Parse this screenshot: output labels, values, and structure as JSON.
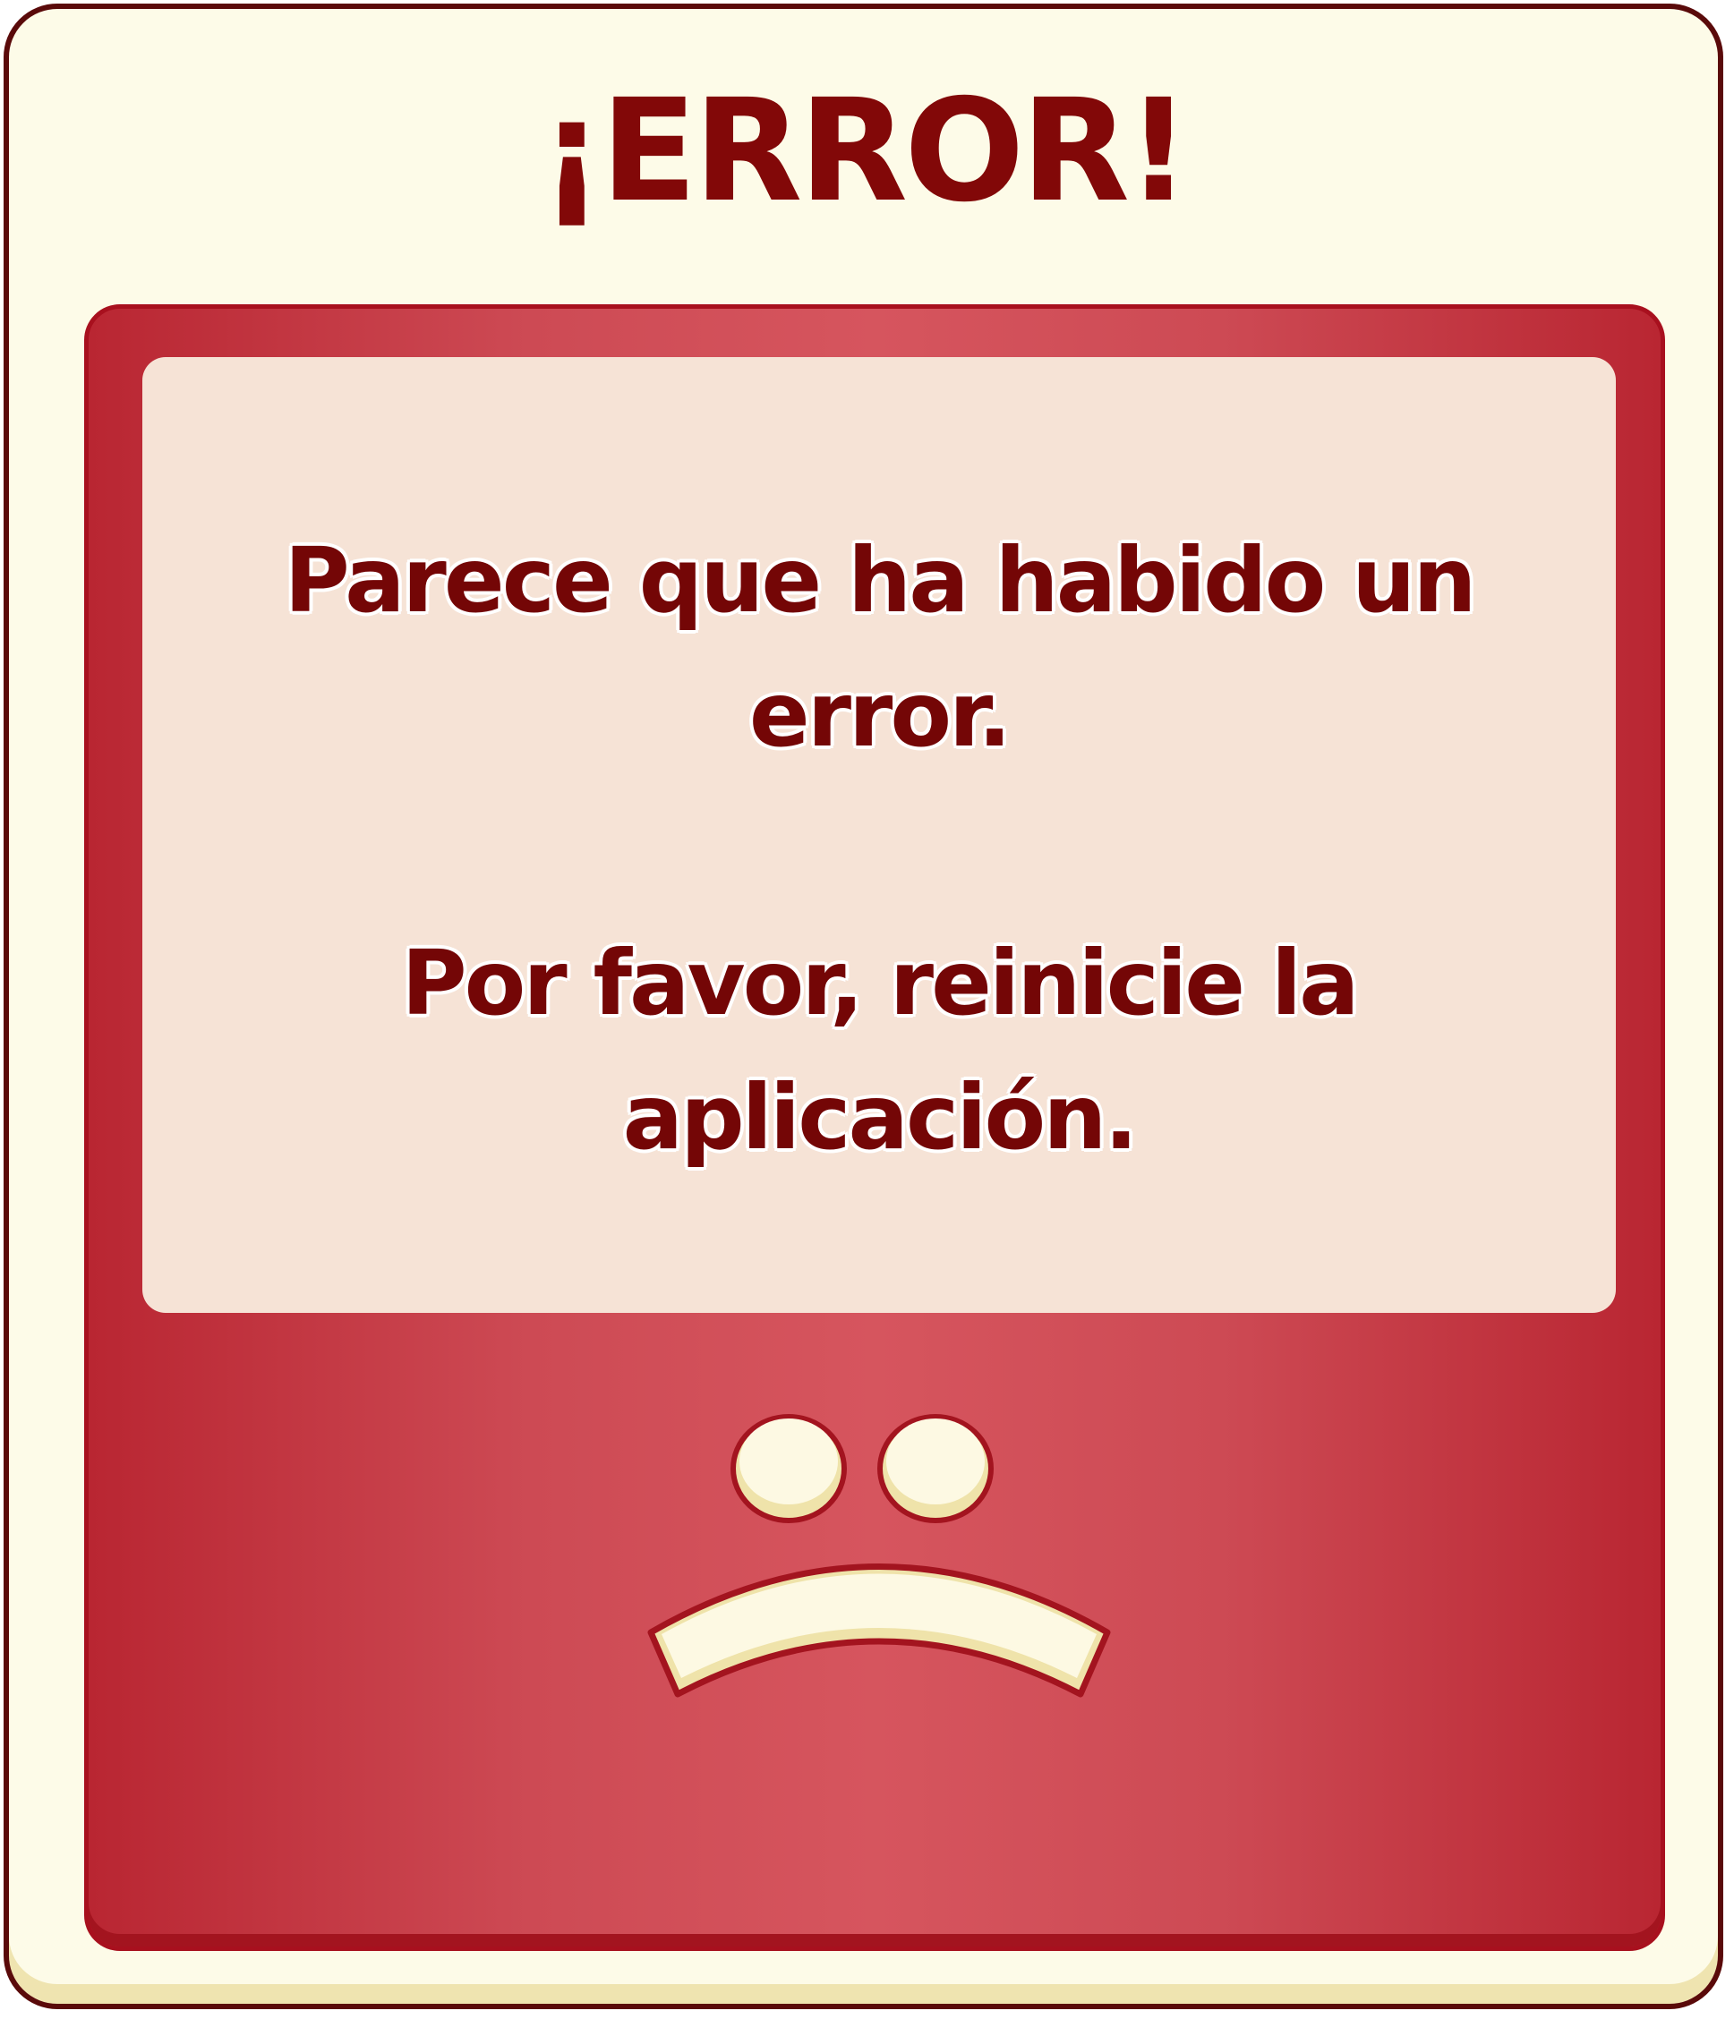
{
  "dialog": {
    "title": "¡ERROR!",
    "message_line_1": "Parece que ha habido un error.",
    "message_line_2": "Por favor, reinicie la aplicación.",
    "face_icon": "sad-face-icon"
  },
  "colors": {
    "frame_border": "#5a0a0a",
    "frame_background": "#fdfbe8",
    "title_text": "#820808",
    "panel_red": "#cd4a54",
    "panel_border": "#a8101e",
    "message_background": "#f6e3d6",
    "message_text": "#740606",
    "face_fill": "#fdf9e3",
    "face_shadow": "#efe3aa"
  }
}
